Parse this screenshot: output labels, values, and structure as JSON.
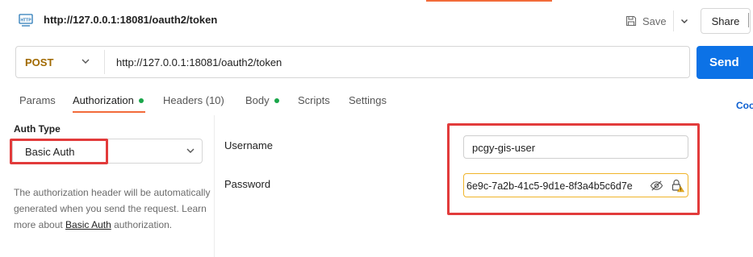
{
  "request": {
    "title": "http://127.0.0.1:18081/oauth2/token",
    "method": "POST",
    "url": "http://127.0.0.1:18081/oauth2/token",
    "icon": "http-icon"
  },
  "toolbar": {
    "save_label": "Save",
    "share_label": "Share",
    "send_label": "Send"
  },
  "tabs": [
    {
      "label": "Params",
      "dot": false
    },
    {
      "label": "Authorization",
      "dot": true,
      "active": true
    },
    {
      "label": "Headers (10)",
      "dot": false
    },
    {
      "label": "Body",
      "dot": true
    },
    {
      "label": "Scripts",
      "dot": false
    },
    {
      "label": "Settings",
      "dot": false
    }
  ],
  "cookies_label": "Coo",
  "auth": {
    "type_label": "Auth Type",
    "type_value": "Basic Auth",
    "description_prefix": "The authorization header will be automatically generated when you send the request. Learn more about ",
    "description_link": "Basic Auth",
    "description_suffix": " authorization."
  },
  "fields": {
    "username_label": "Username",
    "username_value": "pcgy-gis-user",
    "password_label": "Password",
    "password_value": "6e9c-7a2b-41c5-9d1e-8f3a4b5c6d7e"
  },
  "colors": {
    "accent": "#f26b3a",
    "send_button": "#0c72e6",
    "method": "#a06900",
    "status_dot": "#1aa64a",
    "annotation": "#e23b3b",
    "warning_border": "#f0b429"
  }
}
